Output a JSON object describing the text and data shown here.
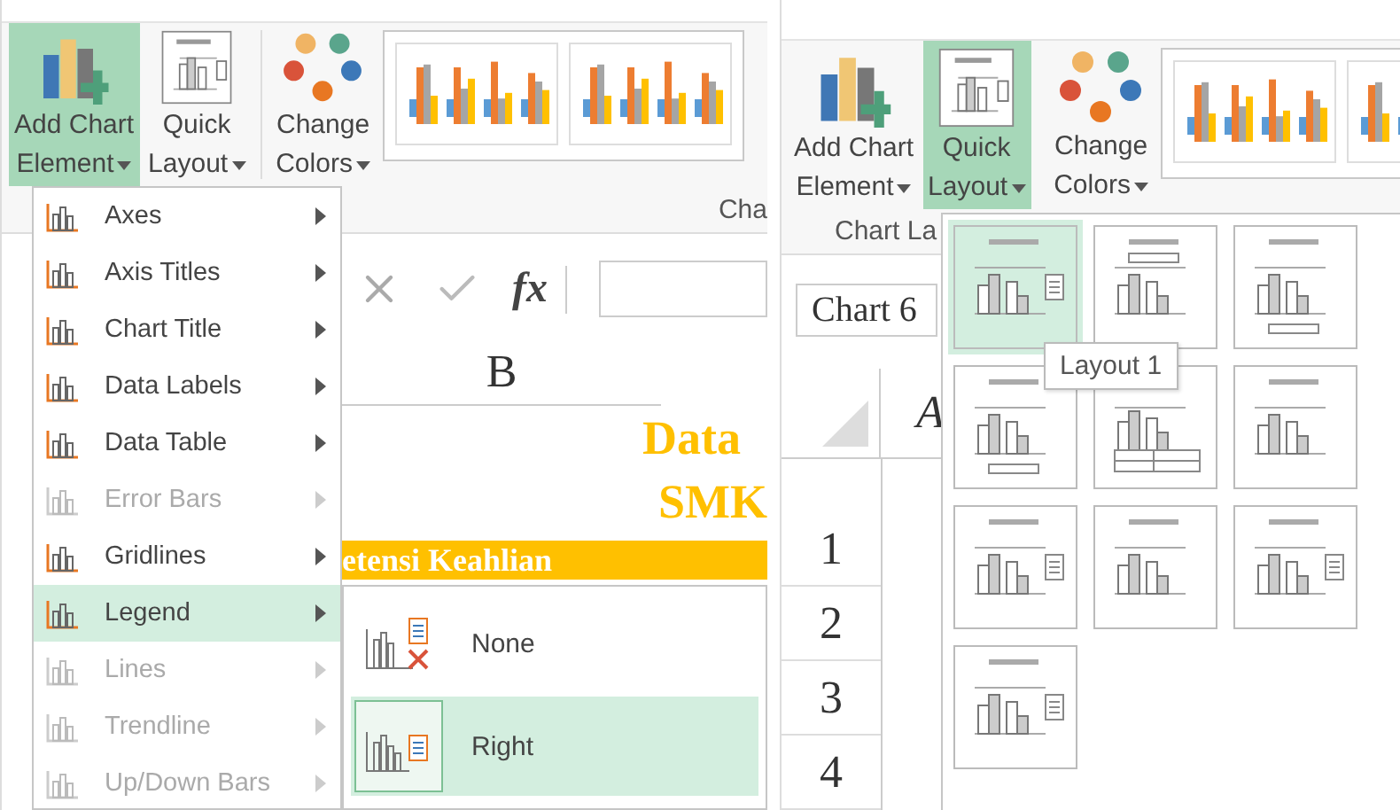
{
  "left": {
    "ribbon": {
      "buttons": [
        {
          "kind": "add",
          "label_lines": [
            "Add Chart",
            "Element"
          ],
          "selected": true
        },
        {
          "kind": "layout",
          "label_lines": [
            "Quick",
            "Layout"
          ],
          "selected": false
        },
        {
          "kind": "colors",
          "label_lines": [
            "Change",
            "Colors"
          ],
          "selected": false
        }
      ],
      "group_label": "Cha"
    },
    "formula_bar": {
      "function_label": "fx"
    },
    "sheet": {
      "column_header": "B",
      "title_lines": [
        "Data",
        "SMK"
      ],
      "band_text": "etensi Keahlian"
    },
    "menu": {
      "items": [
        {
          "label": "Axes",
          "disabled": false,
          "selected": false
        },
        {
          "label": "Axis Titles",
          "disabled": false,
          "selected": false
        },
        {
          "label": "Chart Title",
          "disabled": false,
          "selected": false
        },
        {
          "label": "Data Labels",
          "disabled": false,
          "selected": false
        },
        {
          "label": "Data Table",
          "disabled": false,
          "selected": false
        },
        {
          "label": "Error Bars",
          "disabled": true,
          "selected": false
        },
        {
          "label": "Gridlines",
          "disabled": false,
          "selected": false
        },
        {
          "label": "Legend",
          "disabled": false,
          "selected": true
        },
        {
          "label": "Lines",
          "disabled": true,
          "selected": false
        },
        {
          "label": "Trendline",
          "disabled": true,
          "selected": false
        },
        {
          "label": "Up/Down Bars",
          "disabled": true,
          "selected": false
        }
      ]
    },
    "submenu": {
      "items": [
        {
          "label": "None",
          "kind": "none",
          "selected": false
        },
        {
          "label": "Right",
          "kind": "right",
          "selected": true
        }
      ]
    }
  },
  "right": {
    "ribbon": {
      "buttons": [
        {
          "kind": "add",
          "label_lines": [
            "Add Chart",
            "Element"
          ],
          "selected": false
        },
        {
          "kind": "layout",
          "label_lines": [
            "Quick",
            "Layout"
          ],
          "selected": true
        },
        {
          "kind": "colors",
          "label_lines": [
            "Change",
            "Colors"
          ],
          "selected": false
        }
      ],
      "group_label": "Chart La"
    },
    "name_box": "Chart 6",
    "sheet": {
      "column_header": "A",
      "row_numbers": [
        "1",
        "2",
        "3",
        "4"
      ]
    },
    "quick_layouts": [
      {
        "kind": "right",
        "selected": true
      },
      {
        "kind": "top",
        "selected": false
      },
      {
        "kind": "bottom",
        "selected": false
      },
      {
        "kind": "bottom",
        "selected": false
      },
      {
        "kind": "table",
        "selected": false
      },
      {
        "kind": "none",
        "selected": false
      },
      {
        "kind": "right",
        "selected": false
      },
      {
        "kind": "none",
        "selected": false
      },
      {
        "kind": "right",
        "selected": false
      },
      {
        "kind": "right",
        "selected": false
      }
    ],
    "tooltip": "Layout 1"
  }
}
